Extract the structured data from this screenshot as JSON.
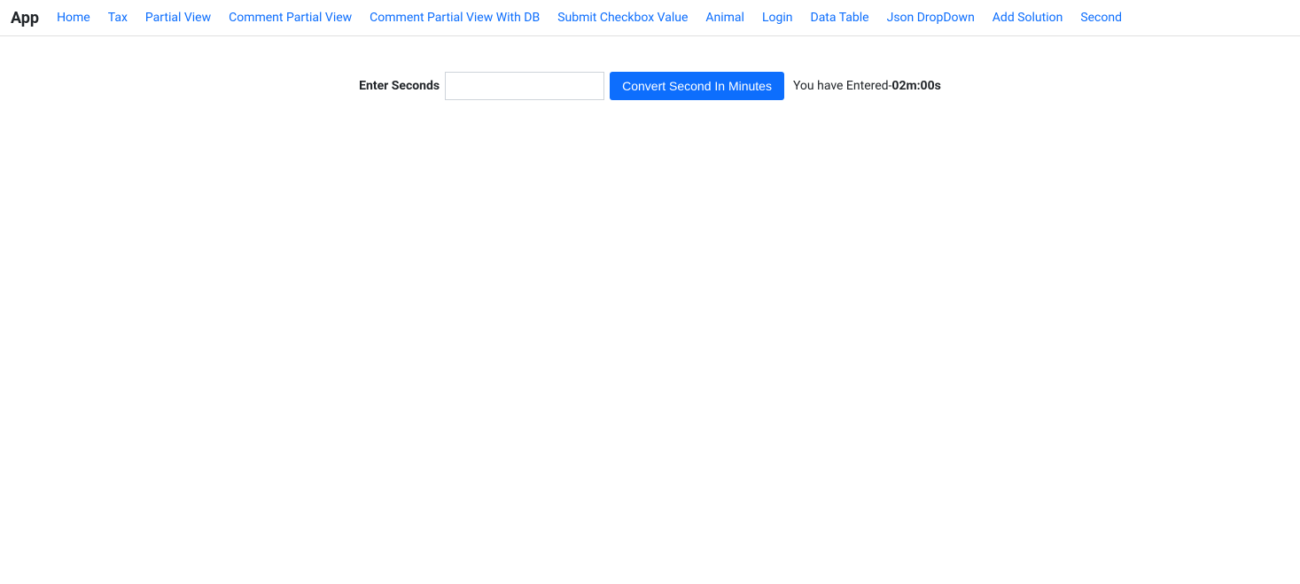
{
  "nav": {
    "brand": "App",
    "links": [
      {
        "label": "Home",
        "href": "#"
      },
      {
        "label": "Tax",
        "href": "#"
      },
      {
        "label": "Partial View",
        "href": "#"
      },
      {
        "label": "Comment Partial View",
        "href": "#"
      },
      {
        "label": "Comment Partial View With DB",
        "href": "#"
      },
      {
        "label": "Submit Checkbox Value",
        "href": "#"
      },
      {
        "label": "Animal",
        "href": "#"
      },
      {
        "label": "Login",
        "href": "#"
      },
      {
        "label": "Data Table",
        "href": "#"
      },
      {
        "label": "Json DropDown",
        "href": "#"
      },
      {
        "label": "Add Solution",
        "href": "#"
      },
      {
        "label": "Second",
        "href": "#"
      }
    ]
  },
  "form": {
    "label": "Enter Seconds",
    "input_value": "",
    "button_label": "Convert Second In Minutes",
    "result_prefix": "You have Entered-",
    "result_value": "02m:00s"
  }
}
